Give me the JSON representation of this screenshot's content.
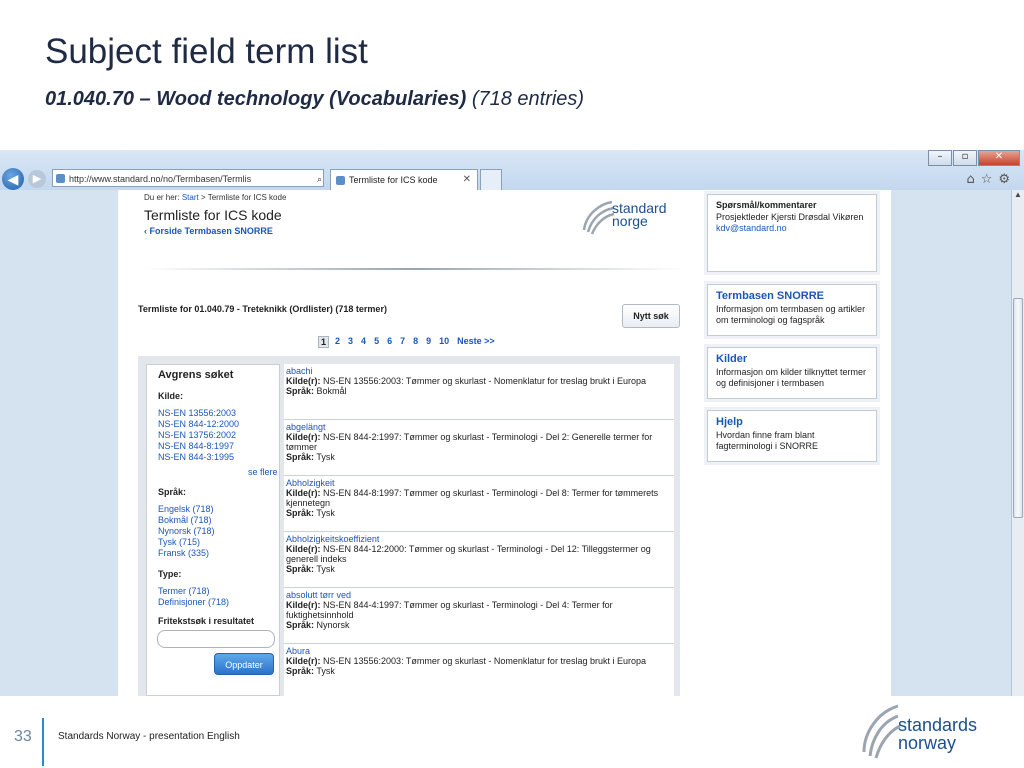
{
  "slide": {
    "title": "Subject field term list",
    "subtitle_bold": "01.040.70 – Wood technology (Vocabularies)",
    "subtitle_rest": "(718 entries)",
    "page_number": "33",
    "footer_text": "Standards Norway - presentation English",
    "footer_logo_line1": "standards",
    "footer_logo_line2": "norway"
  },
  "browser": {
    "address": "http://www.standard.no/no/Termbasen/Termlis",
    "address_icons": "⌕ ▾ ⊠ ↻ ✕",
    "tab_label": "Termliste for ICS kode",
    "tab_close": "✕",
    "window_buttons": [
      "–",
      "▫",
      "✕"
    ],
    "back": "◀",
    "forward": "▶",
    "tools": "⌂☆⚙"
  },
  "page": {
    "breadcrumb_prefix": "Du er her:",
    "breadcrumb_start": "Start",
    "breadcrumb_current": "> Termliste for ICS kode",
    "heading": "Termliste for ICS kode",
    "back_link": "‹ Forside Termbasen SNORRE",
    "logo_line1": "standard",
    "logo_line2": "norge",
    "list_title": "Termliste for 01.040.79 - Treteknikk (Ordlister) (718 termer)",
    "new_search": "Nytt søk",
    "pager": [
      "1",
      "2",
      "3",
      "4",
      "5",
      "6",
      "7",
      "8",
      "9",
      "10",
      "Neste >>"
    ]
  },
  "filter": {
    "title": "Avgrens søket",
    "source_label": "Kilde:",
    "sources": [
      "NS-EN 13556:2003",
      "NS-EN 844-12:2000",
      "NS-EN 13756:2002",
      "NS-EN 844-8:1997",
      "NS-EN 844-3:1995"
    ],
    "see_more": "se flere",
    "language_label": "Språk:",
    "languages": [
      "Engelsk (718)",
      "Bokmål (718)",
      "Nynorsk (718)",
      "Tysk (715)",
      "Fransk (335)"
    ],
    "type_label": "Type:",
    "types": [
      "Termer (718)",
      "Definisjoner (718)"
    ],
    "freetext_label": "Fritekstsøk i resultatet",
    "update_button": "Oppdater"
  },
  "entries": [
    {
      "term": "abachi",
      "source_label": "Kilde(r):",
      "source": "NS-EN 13556:2003: Tømmer og skurlast - Nomenklatur for treslag brukt i Europa",
      "lang_label": "Språk:",
      "lang": "Bokmål"
    },
    {
      "term": "abgelängt",
      "source_label": "Kilde(r):",
      "source": "NS-EN 844-2:1997: Tømmer og skurlast - Terminologi - Del 2: Generelle termer for tømmer",
      "lang_label": "Språk:",
      "lang": "Tysk"
    },
    {
      "term": "Abholzigkeit",
      "source_label": "Kilde(r):",
      "source": "NS-EN 844-8:1997: Tømmer og skurlast - Terminologi - Del 8: Termer for tømmerets kjennetegn",
      "lang_label": "Språk:",
      "lang": "Tysk"
    },
    {
      "term": "Abholzigkeitskoeffizient",
      "source_label": "Kilde(r):",
      "source": "NS-EN 844-12:2000: Tømmer og skurlast - Terminologi - Del 12: Tilleggstermer og generell indeks",
      "lang_label": "Språk:",
      "lang": "Tysk"
    },
    {
      "term": "absolutt tørr ved",
      "source_label": "Kilde(r):",
      "source": "NS-EN 844-4:1997: Tømmer og skurlast - Terminologi - Del 4: Termer for fuktighetsinnhold",
      "lang_label": "Språk:",
      "lang": "Nynorsk"
    },
    {
      "term": "Abura",
      "source_label": "Kilde(r):",
      "source": "NS-EN 13556:2003: Tømmer og skurlast - Nomenklatur for treslag brukt i Europa",
      "lang_label": "Språk:",
      "lang": "Tysk"
    }
  ],
  "side_panels": {
    "contact_title": "Spørsmål/kommentarer",
    "contact_body": "Prosjektleder Kjersti Drøsdal Vikøren",
    "contact_email": "kdv@standard.no",
    "snorre_title": "Termbasen SNORRE",
    "snorre_body": "Informasjon om termbasen og artikler om terminologi og fagspråk",
    "sources_title": "Kilder",
    "sources_body": "Informasjon om kilder tilknyttet termer og definisjoner i termbasen",
    "help_title": "Hjelp",
    "help_body": "Hvordan finne fram blant fagterminologi i SNORRE"
  }
}
